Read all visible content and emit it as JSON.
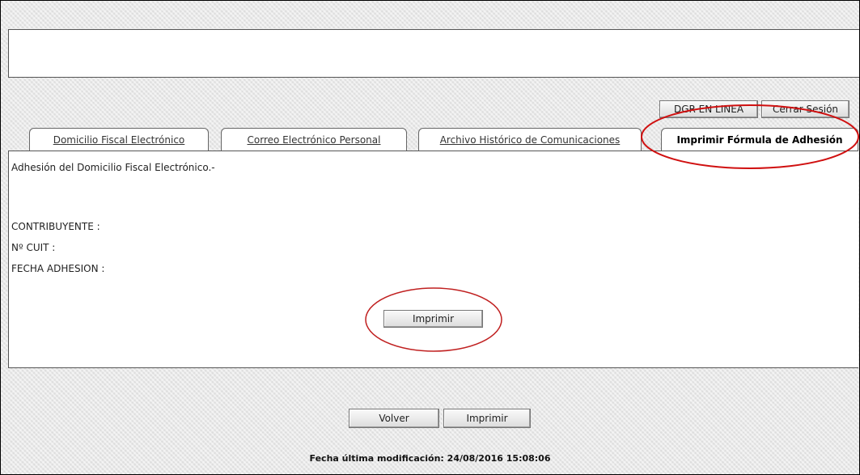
{
  "header": {
    "dgr_button": "DGR EN LINEA",
    "logout_button": "Cerrar Sesión"
  },
  "tabs": [
    {
      "label": "Domicilio Fiscal Electrónico"
    },
    {
      "label": "Correo Electrónico Personal"
    },
    {
      "label": "Archivo Histórico de Comunicaciones"
    },
    {
      "label": "Imprimir Fórmula de Adhesión",
      "active": true
    }
  ],
  "panel": {
    "heading": "Adhesión del Domicilio Fiscal Electrónico.-",
    "fields": [
      {
        "label": "CONTRIBUYENTE :"
      },
      {
        "label": "Nº CUIT :"
      },
      {
        "label": "FECHA ADHESION :"
      }
    ],
    "print_button": "Imprimir"
  },
  "footer": {
    "back_button": "Volver",
    "print_button": "Imprimir",
    "last_modified": "Fecha última modificación: 24/08/2016 15:08:06"
  },
  "colors": {
    "annotation": "#d01010",
    "background": "#e9e9e9"
  }
}
